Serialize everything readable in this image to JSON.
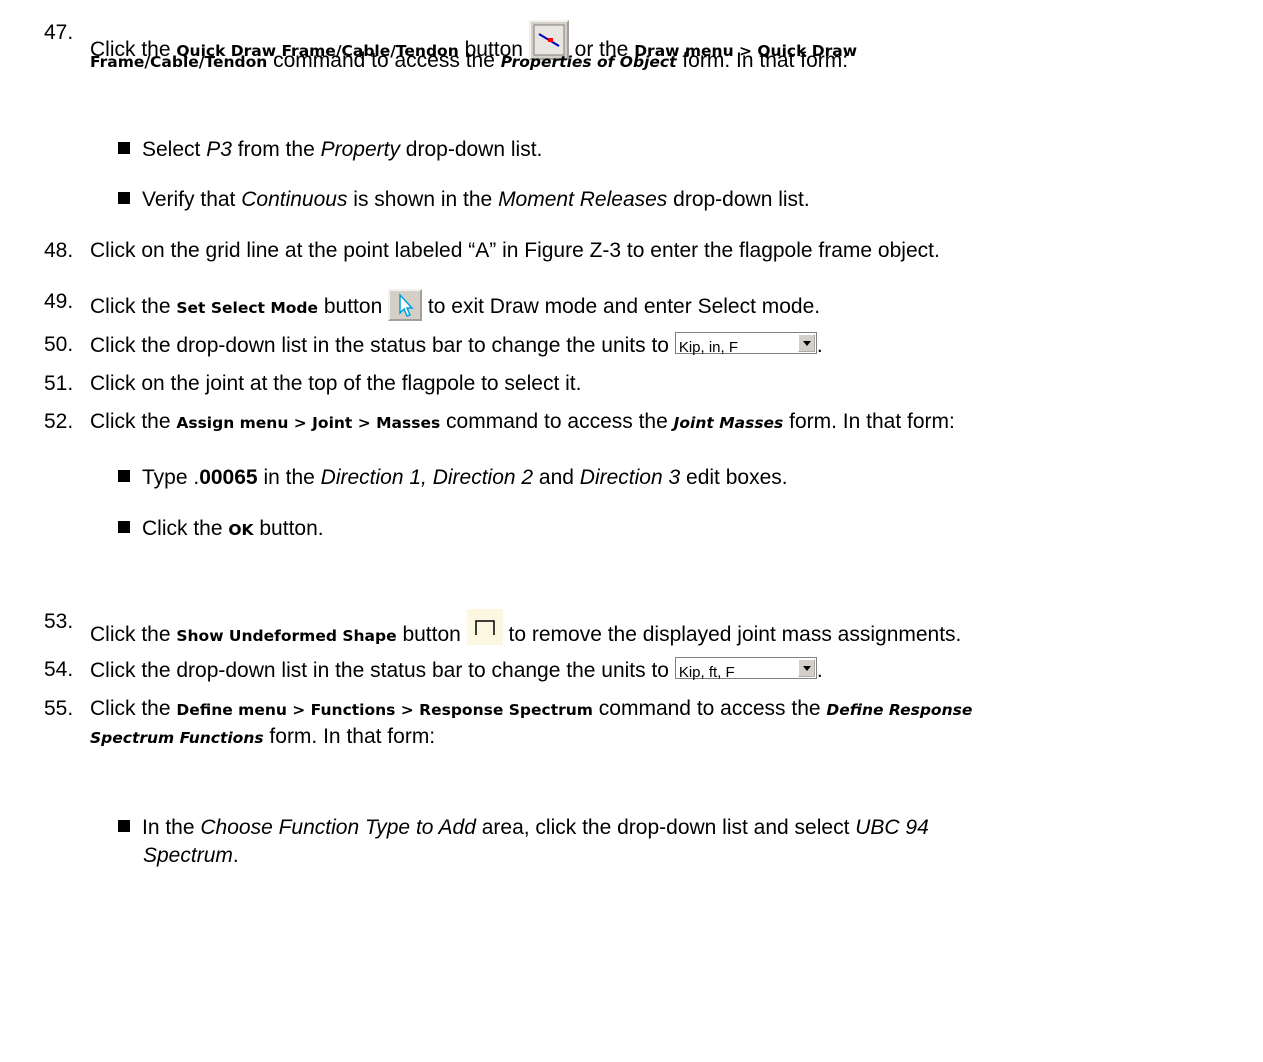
{
  "steps": [
    {
      "num": "47.",
      "l1_a": "Click the ",
      "l1_cmd1": "Quick Draw Frame/Cable/Tendon",
      "l1_b": " button ",
      "l1_c": " or the ",
      "l1_cmd2": "Draw menu > Quick Draw",
      "l2_cmd": "Frame/Cable/Tendon",
      "l2_a": " command to access the ",
      "l2_form": "Properties of Object",
      "l2_b": " form. In that form:",
      "icon": "quick-draw-frame-icon",
      "subs": [
        {
          "a": "Select ",
          "i1": "P3",
          "b": " from the ",
          "i2": "Property",
          "c": " drop-down list."
        },
        {
          "a": "Verify that ",
          "i1": "Continuous",
          "b": " is shown in the ",
          "i2": "Moment Releases",
          "c": " drop-down list."
        }
      ]
    },
    {
      "num": "48.",
      "text": "Click on the grid line at the point labeled “A” in Figure Z-3 to enter the flagpole frame object."
    },
    {
      "num": "49.",
      "a": "Click the ",
      "cmd": "Set Select Mode",
      "b": " button ",
      "c": " to exit Draw mode and enter Select mode.",
      "icon": "arrow-pointer-icon"
    },
    {
      "num": "50.",
      "a": "Click the drop-down list in the status bar to change the units to ",
      "unit": "Kip, in, F",
      "end": "."
    },
    {
      "num": "51.",
      "text": "Click on the joint at the top of the flagpole to select it."
    },
    {
      "num": "52.",
      "a": "Click the ",
      "cmd": "Assign menu > Joint > Masses",
      "b": " command to access the ",
      "form": "Joint Masses",
      "c": " form. In that form:",
      "subs": [
        {
          "a": "Type .",
          "b1": "00065",
          "b": " in the ",
          "i1": "Direction 1, Direction 2",
          "c": " and ",
          "i2": "Direction 3",
          "d": " edit boxes."
        },
        {
          "a": "Click the ",
          "cmd": "OK",
          "b": " button."
        }
      ]
    },
    {
      "num": "53.",
      "a": "Click the ",
      "cmd": "Show Undeformed Shape",
      "b": " button ",
      "c": " to remove the displayed joint mass assignments.",
      "icon": "undeformed-shape-icon"
    },
    {
      "num": "54.",
      "a": "Click the drop-down list in the status bar to change the units to ",
      "unit": "Kip, ft, F",
      "end": "."
    },
    {
      "num": "55.",
      "a": "Click the ",
      "cmd": "Define menu > Functions > Response Spectrum",
      "b": " command to access the ",
      "form1": "Define Response",
      "form2": "Spectrum Functions",
      "c": " form. In that form:",
      "subs": [
        {
          "a": "In the ",
          "i1": "Choose Function Type to Add",
          "b": " area, click the drop-down list and select ",
          "i2": "UBC 94",
          "i3": "Spectrum",
          "c": "."
        }
      ]
    }
  ],
  "colors": {
    "button_face": "#d4d0c8",
    "icon_red": "#ff0000",
    "icon_blue": "#0000cc",
    "pointer_cyan": "#00c0ff"
  }
}
